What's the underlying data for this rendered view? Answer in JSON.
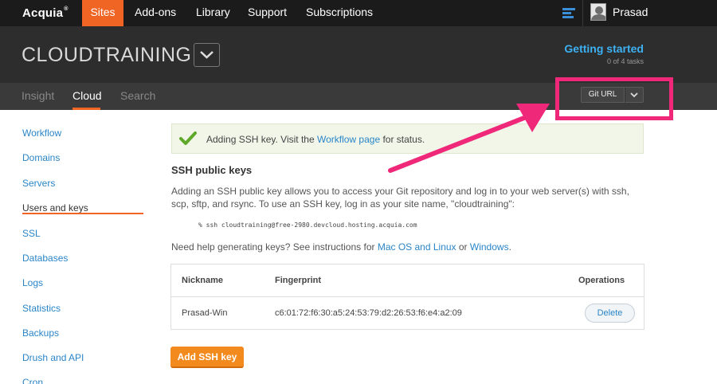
{
  "topbar": {
    "logo": "Acquia",
    "nav": [
      "Sites",
      "Add-ons",
      "Library",
      "Support",
      "Subscriptions"
    ],
    "user": "Prasad"
  },
  "header": {
    "site_name": "CLOUDTRAINING",
    "getting_started": "Getting started",
    "tasks": "0 of 4 tasks"
  },
  "subnav": {
    "tabs": [
      "Insight",
      "Cloud",
      "Search"
    ],
    "git_url_label": "Git URL"
  },
  "sidebar": {
    "items": [
      "Workflow",
      "Domains",
      "Servers",
      "Users and keys",
      "SSL",
      "Databases",
      "Logs",
      "Statistics",
      "Backups",
      "Drush and API",
      "Cron"
    ]
  },
  "notice": {
    "prefix": "Adding SSH key. Visit the ",
    "link": "Workflow page",
    "suffix": " for status."
  },
  "ssh": {
    "title": "SSH public keys",
    "description": "Adding an SSH public key allows you to access your Git repository and log in to your web server(s) with ssh, scp, sftp, and rsync. To use an SSH key, log in as your site name, \"cloudtraining\":",
    "command": "% ssh cloudtraining@free-2980.devcloud.hosting.acquia.com",
    "help_prefix": "Need help generating keys? See instructions for ",
    "help_link1": "Mac OS and Linux",
    "help_or": " or ",
    "help_link2": "Windows",
    "help_suffix": "."
  },
  "keys_table": {
    "headers": [
      "Nickname",
      "Fingerprint",
      "Operations"
    ],
    "rows": [
      {
        "nickname": "Prasad-Win",
        "fingerprint": "c6:01:72:f6:30:a5:24:53:79:d2:26:53:f6:e4:a2:09",
        "action": "Delete"
      }
    ]
  },
  "add_key_label": "Add SSH key",
  "colors": {
    "accent": "#f06524",
    "link": "#2a85c8",
    "highlight": "#f0287a"
  }
}
